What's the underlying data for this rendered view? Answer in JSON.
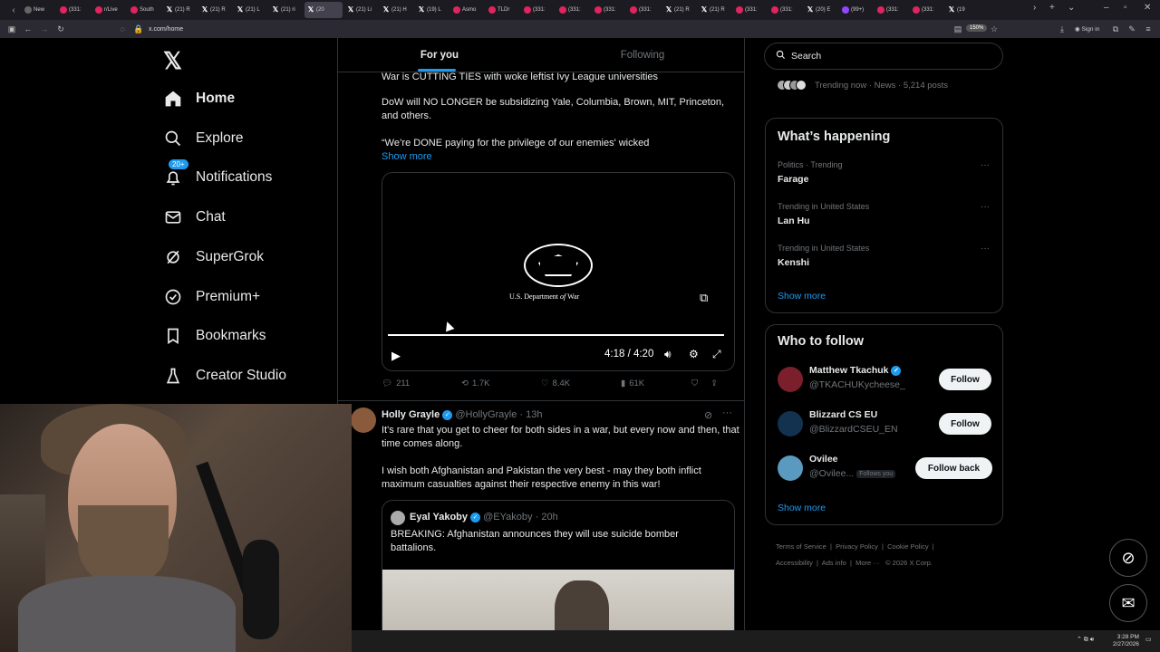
{
  "browser": {
    "url": "x.com/home",
    "zoom": "150%",
    "sign_in": "Sign in",
    "tabs": [
      {
        "label": "New",
        "icon": "grey"
      },
      {
        "label": "(331:",
        "icon": "red"
      },
      {
        "label": "r/Live",
        "icon": "red"
      },
      {
        "label": "South",
        "icon": "red"
      },
      {
        "label": "(21) R",
        "icon": "x"
      },
      {
        "label": "(21) R",
        "icon": "x"
      },
      {
        "label": "(21) L",
        "icon": "x"
      },
      {
        "label": "(21) ri",
        "icon": "x"
      },
      {
        "label": "(20",
        "icon": "x",
        "active": true
      },
      {
        "label": "(21) Li",
        "icon": "x"
      },
      {
        "label": "(21) H",
        "icon": "x"
      },
      {
        "label": "(19) L",
        "icon": "x"
      },
      {
        "label": "Asmo",
        "icon": "red"
      },
      {
        "label": "TLDr",
        "icon": "red"
      },
      {
        "label": "(331:",
        "icon": "red"
      },
      {
        "label": "(331:",
        "icon": "red"
      },
      {
        "label": "(331:",
        "icon": "red"
      },
      {
        "label": "(331:",
        "icon": "red"
      },
      {
        "label": "(21) R",
        "icon": "x"
      },
      {
        "label": "(21) R",
        "icon": "x"
      },
      {
        "label": "(331:",
        "icon": "red"
      },
      {
        "label": "(331:",
        "icon": "red"
      },
      {
        "label": "(20) E",
        "icon": "x"
      },
      {
        "label": "(99+)",
        "icon": "purple"
      },
      {
        "label": "(331:",
        "icon": "red"
      },
      {
        "label": "(331:",
        "icon": "red"
      },
      {
        "label": "(19",
        "icon": "x"
      }
    ]
  },
  "nav": {
    "home": "Home",
    "explore": "Explore",
    "notifications": "Notifications",
    "notifications_badge": "20+",
    "chat": "Chat",
    "supergrok": "SuperGrok",
    "premium": "Premium+",
    "bookmarks": "Bookmarks",
    "creator_studio": "Creator Studio"
  },
  "feed": {
    "tabs": {
      "for_you": "For you",
      "following": "Following"
    },
    "post1": {
      "line1": "War is CUTTING TIES with woke leftist Ivy League universities",
      "line2": "DoW will NO LONGER be subsidizing Yale, Columbia, Brown, MIT, Princeton, and others.",
      "line3": "“We’re DONE paying for the privilege of our enemies' wicked",
      "show_more": "Show more",
      "video_caption_1": "U.S. Department ",
      "video_caption_2": "of",
      "video_caption_3": " War",
      "video_time": "4:18 / 4:20",
      "video_progress": 0.99,
      "replies": "211",
      "reposts": "1.7K",
      "likes": "8.4K",
      "views": "61K"
    },
    "post2": {
      "name": "Holly Grayle",
      "handle": "@HollyGrayle",
      "time": "13h",
      "text1": "It's rare that you get to cheer for both sides in a war, but every now and then, that time comes along.",
      "text2": "I wish both Afghanistan and Pakistan the very best - may they both inflict maximum casualties against their respective enemy in this war!",
      "quote": {
        "name": "Eyal Yakoby",
        "handle": "@EYakoby",
        "time": "20h",
        "text": "BREAKING: Afghanistan announces they will use suicide bomber battalions."
      }
    }
  },
  "sidebar": {
    "search_placeholder": "Search",
    "trending_now": "Trending now · News · 5,214 posts",
    "whats_happening": {
      "title": "What’s happening",
      "items": [
        {
          "meta": "Politics · Trending",
          "name": "Farage"
        },
        {
          "meta": "Trending in United States",
          "name": "Lan Hu"
        },
        {
          "meta": "Trending in United States",
          "name": "Kenshi"
        }
      ],
      "show_more": "Show more"
    },
    "who_to_follow": {
      "title": "Who to follow",
      "accounts": [
        {
          "name": "Matthew Tkachuk",
          "handle": "@TKACHUKycheese_",
          "button": "Follow",
          "color": "#7a1f2b"
        },
        {
          "name": "Blizzard CS EU",
          "handle": "@BlizzardCSEU_EN",
          "button": "Follow",
          "color": "#13324f"
        },
        {
          "name": "Ovilee",
          "handle": "@Ovilee...",
          "follows_you": "Follows you",
          "button": "Follow back",
          "color": "#5a9ac0"
        }
      ],
      "show_more": "Show more"
    },
    "footer": {
      "links": [
        "Terms of Service",
        "Privacy Policy",
        "Cookie Policy",
        "Accessibility",
        "Ads info",
        "More ···"
      ],
      "copyright": "© 2026 X Corp."
    }
  },
  "taskbar": {
    "time": "3:28 PM",
    "date": "2/27/2026"
  }
}
